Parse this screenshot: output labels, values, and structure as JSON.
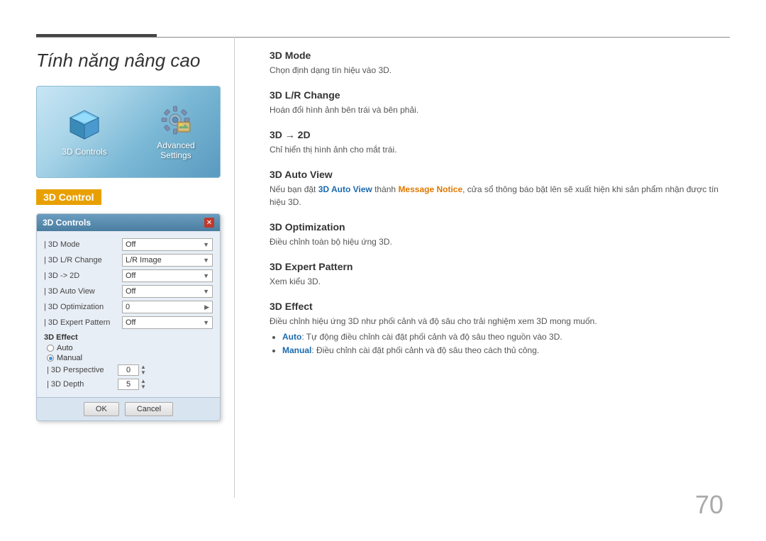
{
  "page": {
    "title": "Tính năng nâng cao",
    "page_number": "70"
  },
  "icon_panel": {
    "item1_label": "3D Controls",
    "item2_label": "Advanced\nSettings"
  },
  "section_header": "3D Control",
  "dialog": {
    "title": "3D Controls",
    "close_btn": "✕",
    "rows": [
      {
        "label": "| 3D Mode",
        "value": "Off"
      },
      {
        "label": "| 3D L/R Change",
        "value": "L/R Image"
      },
      {
        "label": "| 3D -> 2D",
        "value": "Off"
      },
      {
        "label": "| 3D Auto View",
        "value": "Off"
      },
      {
        "label": "| 3D Optimization",
        "value": "0"
      },
      {
        "label": "| 3D Expert Pattern",
        "value": "Off"
      }
    ],
    "effect_label": "3D Effect",
    "radio_auto": "Auto",
    "radio_manual": "Manual",
    "perspective_label": "| 3D Perspective",
    "perspective_value": "0",
    "depth_label": "| 3D Depth",
    "depth_value": "5",
    "ok_btn": "OK",
    "cancel_btn": "Cancel"
  },
  "features": [
    {
      "title": "3D Mode",
      "desc": "Chọn định dạng tín hiệu vào 3D."
    },
    {
      "title": "3D L/R Change",
      "desc": "Hoán đổi hình ảnh bên trái và bên phải."
    },
    {
      "title": "3D → 2D",
      "desc": "Chỉ hiển thị hình ảnh cho mắt trái."
    },
    {
      "title": "3D Auto View",
      "desc_parts": [
        {
          "text": "Nếu bạn đặt ",
          "type": "normal"
        },
        {
          "text": "3D Auto View",
          "type": "blue"
        },
        {
          "text": " thành ",
          "type": "normal"
        },
        {
          "text": "Message Notice",
          "type": "orange"
        },
        {
          "text": ", cửa sổ thông báo bật lên sẽ xuất hiện khi sản phẩm nhận được tín hiệu 3D.",
          "type": "normal"
        }
      ]
    },
    {
      "title": "3D Optimization",
      "desc": "Điều chỉnh toàn bộ hiệu ứng 3D."
    },
    {
      "title": "3D Expert Pattern",
      "desc": "Xem kiểu 3D."
    },
    {
      "title": "3D Effect",
      "desc": "Điều chỉnh hiệu ứng 3D như phối cảnh và độ sâu cho trải nghiệm xem 3D mong muốn.",
      "bullets": [
        {
          "parts": [
            {
              "text": "Auto",
              "type": "blue"
            },
            {
              "text": ": Tự động điều chỉnh cài đặt phối cảnh và độ sâu theo nguồn vào 3D.",
              "type": "normal"
            }
          ]
        },
        {
          "parts": [
            {
              "text": "Manual",
              "type": "blue"
            },
            {
              "text": ": Điều chỉnh cài đặt phối cảnh và độ sâu theo cách thủ công.",
              "type": "normal"
            }
          ]
        }
      ]
    }
  ]
}
